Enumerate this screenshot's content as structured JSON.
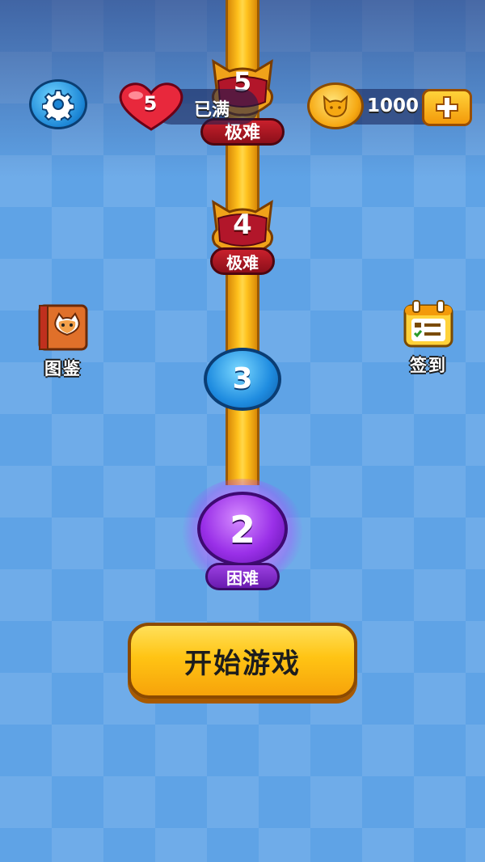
{
  "header": {
    "settings_icon": "gear-icon",
    "lives": {
      "count": "5",
      "status": "已满",
      "icon": "heart-icon"
    },
    "coins": {
      "count": "1000",
      "icon": "cat-coin-icon",
      "add_icon": "plus-icon"
    }
  },
  "levels": [
    {
      "number": "5",
      "difficulty": "极难",
      "style": "cat-red"
    },
    {
      "number": "4",
      "difficulty": "极难",
      "style": "cat-red"
    },
    {
      "number": "3",
      "difficulty": "",
      "style": "blue"
    },
    {
      "number": "2",
      "difficulty": "困难",
      "style": "purple-current"
    }
  ],
  "side": {
    "left": {
      "label": "图鉴",
      "icon": "cat-book-icon"
    },
    "right": {
      "label": "签到",
      "icon": "calendar-icon"
    }
  },
  "start_button": {
    "label": "开始游戏"
  },
  "colors": {
    "background": "#5fa3e6",
    "path": "#ffc21e",
    "hard_red": "#c8202c",
    "current_purple": "#9a30e8",
    "button_yellow": "#ffc414"
  }
}
